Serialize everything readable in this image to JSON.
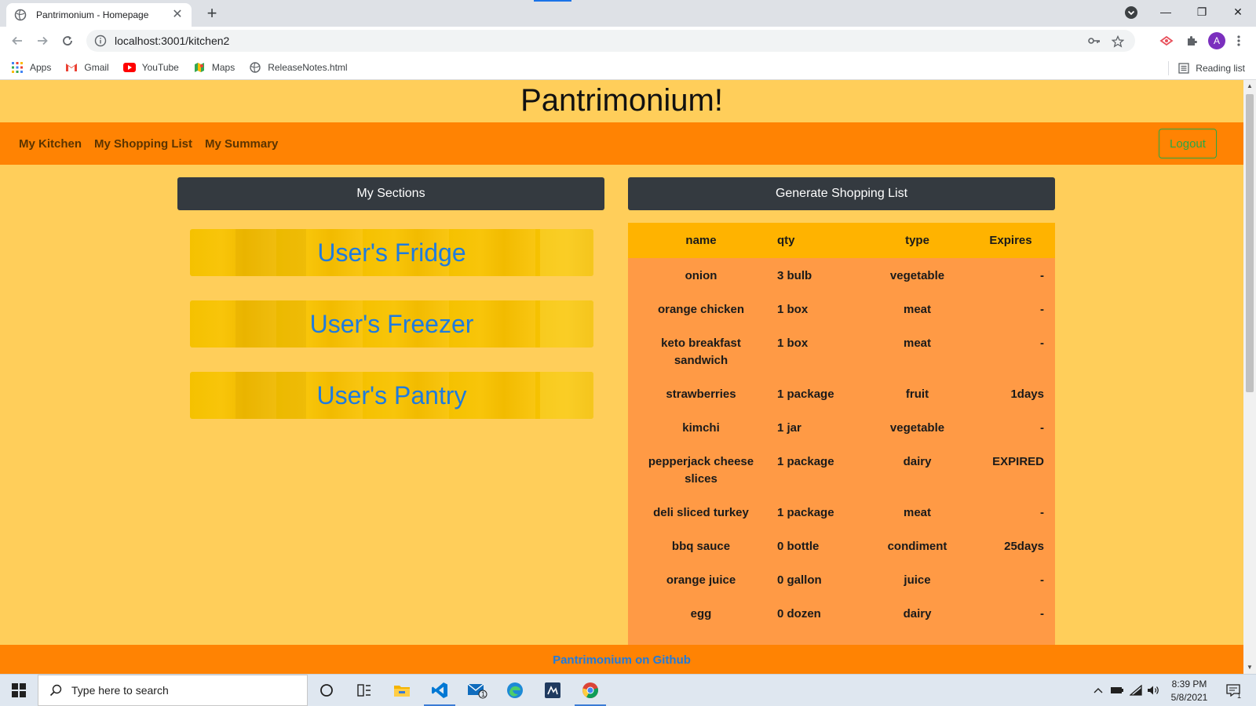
{
  "browser": {
    "tab_title": "Pantrimonium - Homepage",
    "url": "localhost:3001/kitchen2",
    "avatar_letter": "A",
    "bookmarks": [
      {
        "label": "Apps"
      },
      {
        "label": "Gmail"
      },
      {
        "label": "YouTube"
      },
      {
        "label": "Maps"
      },
      {
        "label": "ReleaseNotes.html"
      }
    ],
    "reading_list": "Reading list"
  },
  "site": {
    "title": "Pantrimonium!",
    "nav": [
      "My Kitchen",
      "My Shopping List",
      "My Summary"
    ],
    "logout": "Logout",
    "sections_button": "My Sections",
    "generate_button": "Generate Shopping List",
    "sections": [
      "User's Fridge",
      "User's Freezer",
      "User's Pantry"
    ],
    "table": {
      "headers": {
        "name": "name",
        "qty": "qty",
        "type": "type",
        "expires": "Expires"
      },
      "rows": [
        {
          "name": "onion",
          "qty": "3 bulb",
          "type": "vegetable",
          "expires": "-"
        },
        {
          "name": "orange chicken",
          "qty": "1 box",
          "type": "meat",
          "expires": "-"
        },
        {
          "name": "keto breakfast sandwich",
          "qty": "1 box",
          "type": "meat",
          "expires": "-"
        },
        {
          "name": "strawberries",
          "qty": "1 package",
          "type": "fruit",
          "expires": "1days"
        },
        {
          "name": "kimchi",
          "qty": "1 jar",
          "type": "vegetable",
          "expires": "-"
        },
        {
          "name": "pepperjack cheese slices",
          "qty": "1 package",
          "type": "dairy",
          "expires": "EXPIRED"
        },
        {
          "name": "deli sliced turkey",
          "qty": "1 package",
          "type": "meat",
          "expires": "-"
        },
        {
          "name": "bbq sauce",
          "qty": "0 bottle",
          "type": "condiment",
          "expires": "25days"
        },
        {
          "name": "orange juice",
          "qty": "0 gallon",
          "type": "juice",
          "expires": "-"
        },
        {
          "name": "egg",
          "qty": "0 dozen",
          "type": "dairy",
          "expires": "-"
        }
      ]
    },
    "footer_link": "Pantrimonium on Github"
  },
  "taskbar": {
    "search_placeholder": "Type here to search",
    "time": "8:39 PM",
    "date": "5/8/2021",
    "mail_badge": "1",
    "notif_badge": "1"
  }
}
